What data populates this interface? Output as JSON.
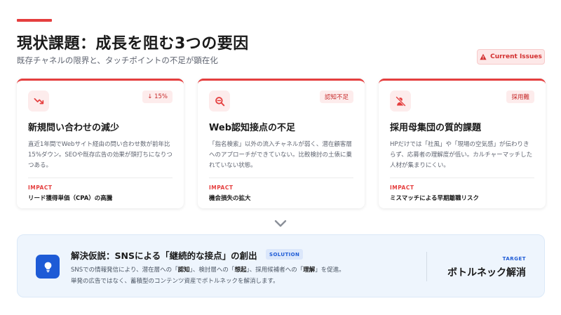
{
  "header": {
    "title": "現状課題：成長を阻む3つの要因",
    "subtitle": "既存チャネルの限界と、タッチポイントの不足が顕在化",
    "badge": "Current Issues"
  },
  "cards": [
    {
      "icon": "trending-down-icon",
      "badge": "↓ 15%",
      "title": "新規問い合わせの減少",
      "description": "直近1年間でWebサイト経由の問い合わせ数が前年比15%ダウン。SEOや既存広告の効果が頭打ちになりつつある。",
      "impact_label": "IMPACT",
      "impact": "リード獲得単価（CPA）の高騰"
    },
    {
      "icon": "search-minus-icon",
      "badge": "認知不足",
      "title": "Web認知接点の不足",
      "description": "「指名検索」以外の流入チャネルが弱く、潜在顧客層へのアプローチができていない。比較検討の土俵に乗れていない状態。",
      "impact_label": "IMPACT",
      "impact": "機会損失の拡大"
    },
    {
      "icon": "user-slash-icon",
      "badge": "採用難",
      "title": "採用母集団の質的課題",
      "description": "HPだけでは「社風」や「現場の空気感」が伝わりきらず、応募者の理解度が低い。カルチャーマッチした人材が集まりにくい。",
      "impact_label": "IMPACT",
      "impact": "ミスマッチによる早期離職リスク"
    }
  ],
  "solution": {
    "icon": "lightbulb-icon",
    "title": "解決仮説：SNSによる「継続的な接点」の創出",
    "tag": "SOLUTION",
    "line1": {
      "t1": "SNSでの情報発信により、潜在層への「",
      "b1": "認知",
      "t2": "」、検討層への「",
      "b2": "想起",
      "t3": "」、採用候補者への「",
      "b3": "理解",
      "t4": "」を促進。"
    },
    "line2": "単発の広告ではなく、蓄積型のコンテンツ資産でボトルネックを解消します。",
    "target_label": "TARGET",
    "target_value": "ボトルネック解消"
  },
  "colors": {
    "accent": "#e53e3e",
    "solution_blue": "#1e5bd6",
    "solution_bg": "#eef5fd"
  }
}
